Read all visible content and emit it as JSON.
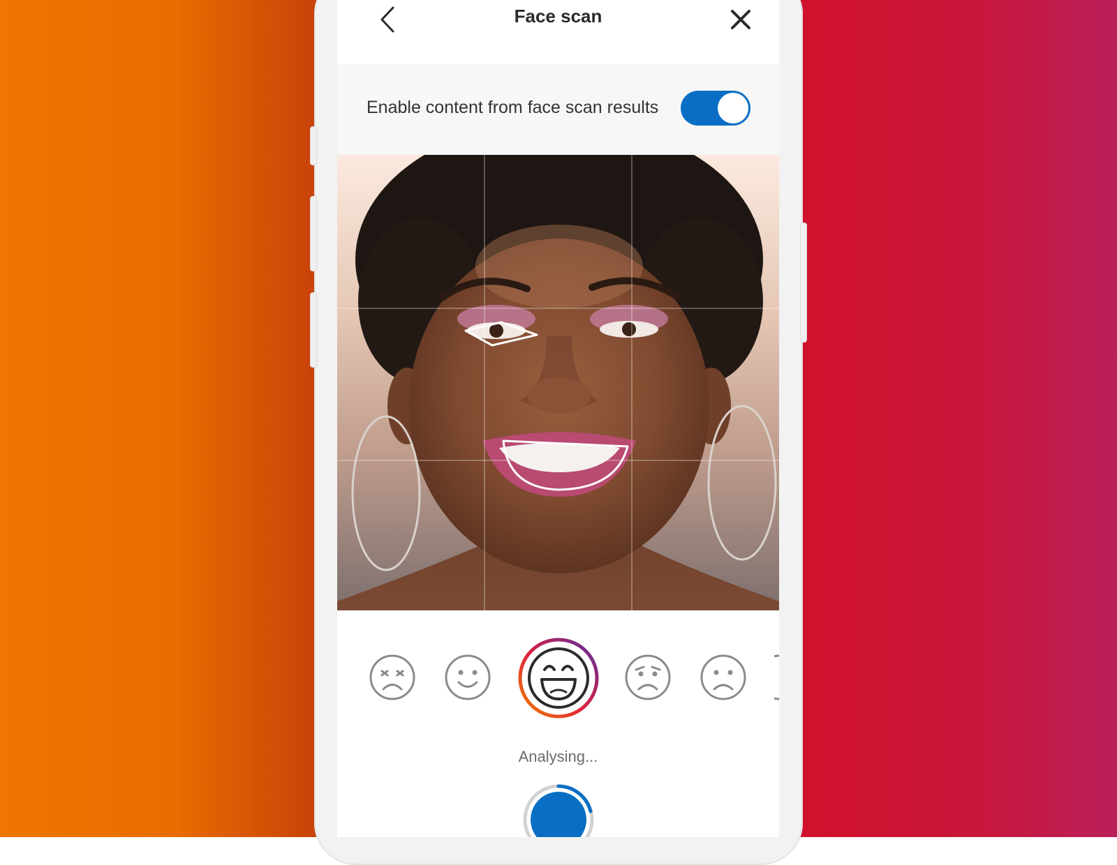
{
  "header": {
    "title": "Face scan",
    "back_icon": "chevron-left-icon",
    "close_icon": "close-icon"
  },
  "settings": {
    "toggle_label": "Enable content from face scan results",
    "toggle_on": true,
    "toggle_color": "#0a6fc4"
  },
  "expressions": {
    "items": [
      "angry-face-icon",
      "smile-face-icon",
      "laughing-face-icon",
      "worried-face-icon",
      "sad-face-icon",
      "partial-face-icon"
    ],
    "selected": "laughing-face-icon"
  },
  "status": {
    "text": "Analysing..."
  },
  "capture": {
    "progress": 0.3,
    "color": "#0a6fc4"
  },
  "colors": {
    "background_left": "#ef7600",
    "background_right": "#d0112c",
    "accent_blue": "#0a6fc4"
  }
}
